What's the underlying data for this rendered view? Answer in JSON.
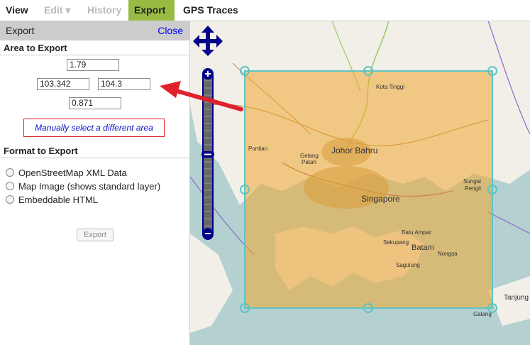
{
  "nav": {
    "tabs": [
      {
        "label": "View",
        "state": "normal"
      },
      {
        "label": "Edit ▾",
        "state": "disabled"
      },
      {
        "label": "History",
        "state": "disabled"
      },
      {
        "label": "Export",
        "state": "active"
      },
      {
        "label": "GPS Traces",
        "state": "normal"
      }
    ]
  },
  "panel": {
    "title": "Export",
    "close_label": "Close",
    "area_title": "Area to Export",
    "bounds": {
      "top": "1.79",
      "left": "103.342",
      "right": "104.3",
      "bottom": "0.871"
    },
    "manual_link": "Manually select a different area",
    "format_title": "Format to Export",
    "formats": [
      "OpenStreetMap XML Data",
      "Map Image (shows standard layer)",
      "Embeddable HTML"
    ],
    "export_label": "Export"
  },
  "map": {
    "labels": [
      "Kota Tinggi",
      "Pontian",
      "Gelang",
      "Patah",
      "Johor Bahru",
      "Sungai",
      "Rengit",
      "Singapore",
      "Batu Ampar",
      "Sekupang",
      "Batam",
      "Nongsa",
      "Sagulung",
      "Tanjung",
      "Galang"
    ],
    "colors": {
      "sea": "#b5d0d0",
      "land": "#f2efe9",
      "selection": "#f0a830",
      "selection_border": "#5fc4c4",
      "arrow": "#e0202a",
      "nav_control": "#00008b"
    }
  }
}
